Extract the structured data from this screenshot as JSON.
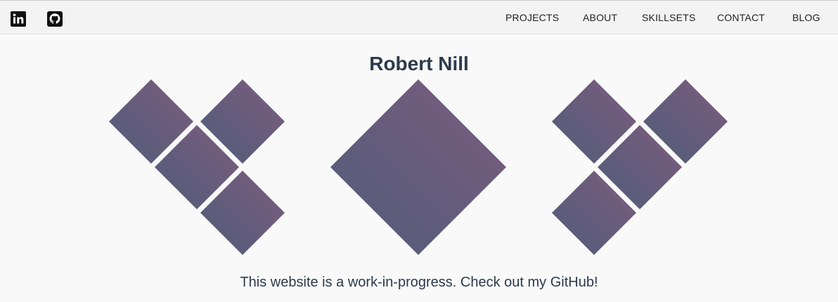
{
  "nav": {
    "social": [
      {
        "name": "linkedin-icon"
      },
      {
        "name": "github-icon"
      }
    ],
    "links": [
      "PROJECTS",
      "ABOUT",
      "SKILLSETS",
      "CONTACT",
      "BLOG"
    ]
  },
  "hero": {
    "title": "Robert Nill",
    "caption": "This website is a work-in-progress. Check out my GitHub!"
  },
  "colors": {
    "nav_background": "#f3f3f3",
    "page_background": "#f9f9f9",
    "text_dark": "#2d3a4a",
    "gradient_start": "#4f5b7a",
    "gradient_end": "#7d5d7d"
  }
}
